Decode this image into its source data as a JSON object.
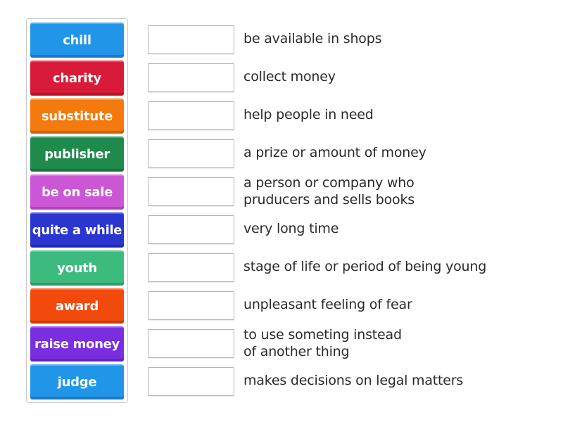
{
  "activity": {
    "type": "match-up",
    "tiles": [
      {
        "label": "chill",
        "color": "#2196e8"
      },
      {
        "label": "charity",
        "color": "#d81b39"
      },
      {
        "label": "substitute",
        "color": "#f57a0e"
      },
      {
        "label": "publisher",
        "color": "#1f8a4c"
      },
      {
        "label": "be on sale",
        "color": "#cc57d6"
      },
      {
        "label": "quite a while",
        "color": "#2b35cf"
      },
      {
        "label": "youth",
        "color": "#3dba7e"
      },
      {
        "label": "award",
        "color": "#f24a0c"
      },
      {
        "label": "raise money",
        "color": "#7a2ee0"
      },
      {
        "label": "judge",
        "color": "#2196e8"
      }
    ],
    "definitions": [
      {
        "text": "be available in shops",
        "slot_value": ""
      },
      {
        "text": "collect money",
        "slot_value": ""
      },
      {
        "text": "help people in need",
        "slot_value": ""
      },
      {
        "text": "a prize or amount of money",
        "slot_value": ""
      },
      {
        "text": "a person or company who\nprudicers and sells books",
        "slot_value": ""
      },
      {
        "text": "very long time",
        "slot_value": ""
      },
      {
        "text": "stage of life or period of being young",
        "slot_value": ""
      },
      {
        "text": "unpleasant feeling of fear",
        "slot_value": ""
      },
      {
        "text": "to use someting instead\nof another thing",
        "slot_value": ""
      },
      {
        "text": "makes decisions on legal matters",
        "slot_value": ""
      }
    ]
  }
}
